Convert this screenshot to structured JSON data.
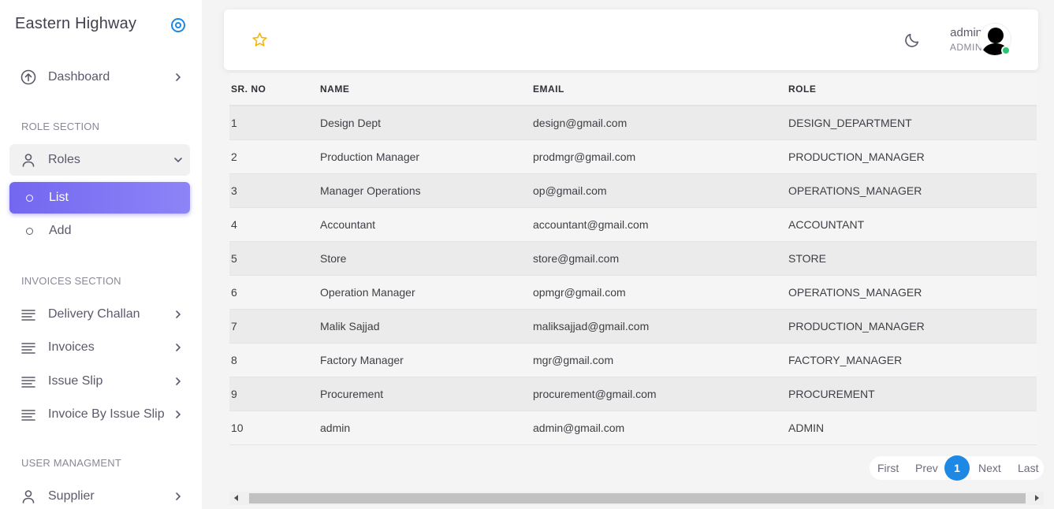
{
  "app": {
    "title": "Eastern Highway"
  },
  "sidebar": {
    "dashboard": "Dashboard",
    "role_section": "ROLE SECTION",
    "roles": "Roles",
    "roles_children": [
      {
        "label": "List",
        "active": true
      },
      {
        "label": "Add",
        "active": false
      }
    ],
    "invoices_section": "INVOICES SECTION",
    "invoice_items": [
      "Delivery Challan",
      "Invoices",
      "Issue Slip",
      "Invoice By Issue Slip"
    ],
    "user_section": "USER MANAGMENT",
    "user_items": [
      "Supplier"
    ]
  },
  "header": {
    "user_name": "admin",
    "user_role": "ADMIN"
  },
  "table": {
    "columns": [
      "SR. NO",
      "NAME",
      "EMAIL",
      "ROLE"
    ],
    "rows": [
      [
        "1",
        "Design Dept",
        "design@gmail.com",
        "DESIGN_DEPARTMENT"
      ],
      [
        "2",
        "Production Manager",
        "prodmgr@gmail.com",
        "PRODUCTION_MANAGER"
      ],
      [
        "3",
        "Manager Operations",
        "op@gmail.com",
        "OPERATIONS_MANAGER"
      ],
      [
        "4",
        "Accountant",
        "accountant@gmail.com",
        "ACCOUNTANT"
      ],
      [
        "5",
        "Store",
        "store@gmail.com",
        "STORE"
      ],
      [
        "6",
        "Operation Manager",
        "opmgr@gmail.com",
        "OPERATIONS_MANAGER"
      ],
      [
        "7",
        "Malik Sajjad",
        "maliksajjad@gmail.com",
        "PRODUCTION_MANAGER"
      ],
      [
        "8",
        "Factory Manager",
        "mgr@gmail.com",
        "FACTORY_MANAGER"
      ],
      [
        "9",
        "Procurement",
        "procurement@gmail.com",
        "PROCUREMENT"
      ],
      [
        "10",
        "admin",
        "admin@gmail.com",
        "ADMIN"
      ]
    ]
  },
  "pagination": {
    "first": "First",
    "prev": "Prev",
    "current": "1",
    "next": "Next",
    "last": "Last"
  },
  "colors": {
    "accent": "#7367f0",
    "primary_blue": "#1e88e5",
    "online": "#28c76f",
    "star": "#f4b400"
  }
}
